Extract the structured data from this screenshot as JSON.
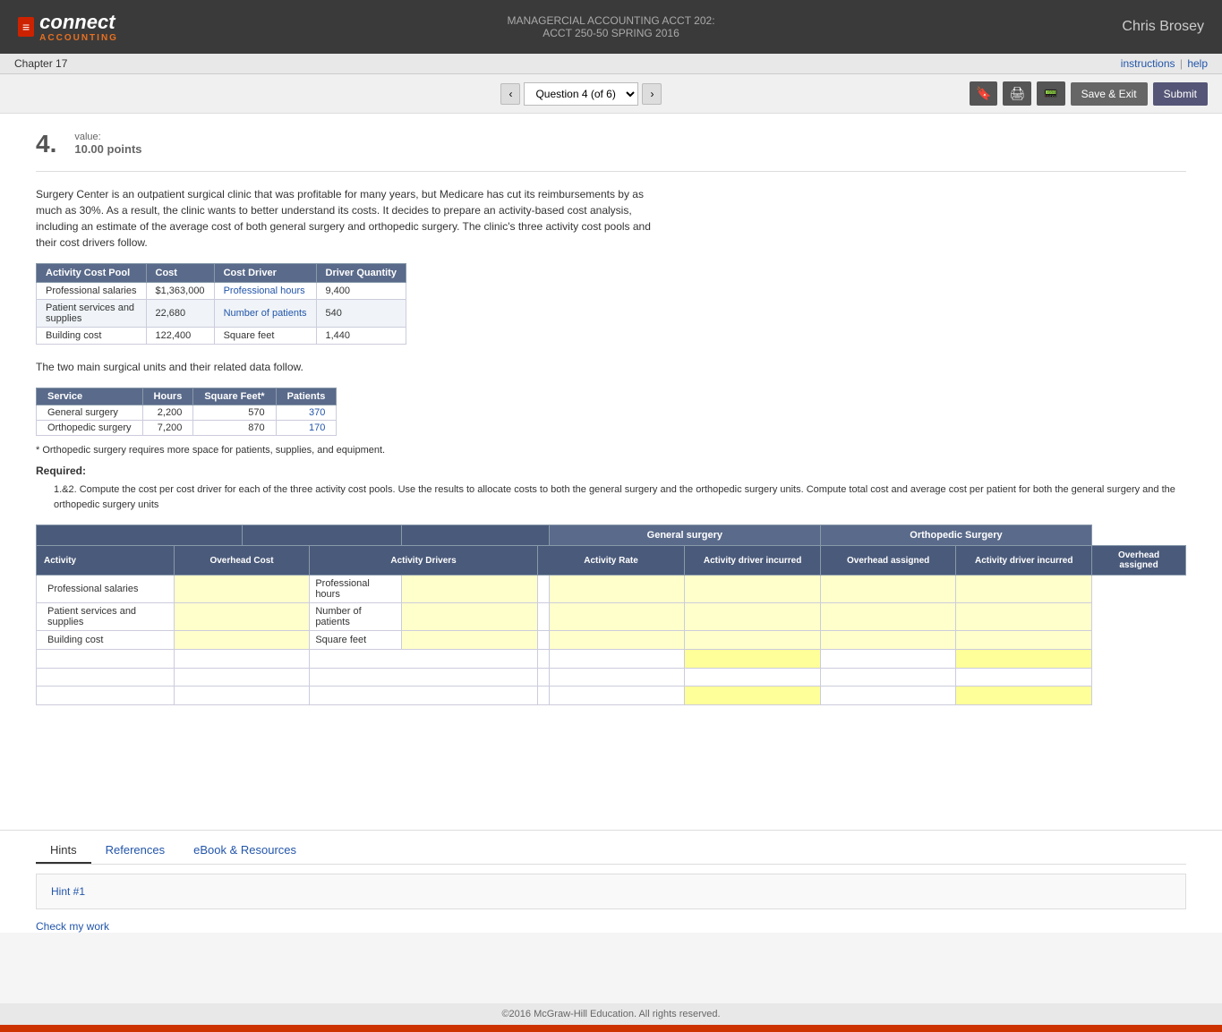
{
  "header": {
    "logo_icon": "≡",
    "logo_text": "connect",
    "logo_subtext": "ACCOUNTING",
    "course_line1": "MANAGERCIAL ACCOUNTING ACCT 202:",
    "course_line2": "ACCT 250-50 SPRING 2016",
    "user": "Chris Brosey"
  },
  "topbar": {
    "chapter": "Chapter 17",
    "links": {
      "instructions": "instructions",
      "separator": "|",
      "help": "help"
    }
  },
  "nav": {
    "prev_label": "‹",
    "question_select": "Question 4 (of 6)",
    "next_label": "›",
    "save_exit": "Save & Exit",
    "submit": "Submit"
  },
  "question": {
    "number": "4.",
    "value_label": "value:",
    "points": "10.00 points"
  },
  "problem": {
    "intro": "Surgery Center is an outpatient surgical clinic that was profitable for many years, but Medicare has cut its reimbursements by as much as 30%. As a result, the clinic wants to better understand its costs. It decides to prepare an activity-based cost analysis, including an estimate of the average cost of both general surgery and orthopedic surgery. The clinic's three activity cost pools and their cost drivers follow.",
    "cost_pool_table": {
      "headers": [
        "Activity Cost Pool",
        "Cost",
        "Cost Driver",
        "Driver Quantity"
      ],
      "rows": [
        [
          "Professional salaries",
          "$1,363,000",
          "Professional hours",
          "9,400"
        ],
        [
          "Patient services and supplies",
          "22,680",
          "Number of patients",
          "540"
        ],
        [
          "Building cost",
          "122,400",
          "Square feet",
          "1,440"
        ]
      ]
    },
    "service_table": {
      "headers": [
        "Service",
        "Hours",
        "Square Feet*",
        "Patients"
      ],
      "rows": [
        [
          "General surgery",
          "2,200",
          "570",
          "370"
        ],
        [
          "Orthopedic surgery",
          "7,200",
          "870",
          "170"
        ]
      ]
    },
    "footnote": "* Orthopedic surgery requires more space for patients, supplies, and equipment.",
    "required_label": "Required:",
    "required_detail": "1.&2. Compute the cost per cost driver for each of the three activity cost pools. Use the results to allocate costs to both the general surgery and the orthopedic surgery units. Compute total cost and average cost per patient for both the general surgery and the orthopedic surgery units"
  },
  "answer_table": {
    "col_groups": {
      "general_surgery": "General surgery",
      "orthopedic_surgery": "Orthopedic Surgery"
    },
    "sub_headers": {
      "activity": "Activity",
      "overhead_cost": "Overhead Cost",
      "activity_drivers": "Activity Drivers",
      "activity_rate": "Activity Rate",
      "gen_driver_incurred": "Activity driver incurred",
      "gen_overhead_assigned": "Overhead assigned",
      "orth_driver_incurred": "Activity driver incurred",
      "orth_overhead_assigned": "Overhead assigned"
    },
    "rows": [
      {
        "activity": "Professional salaries",
        "driver": "Professional hours"
      },
      {
        "activity": "Patient services and supplies",
        "driver": "Number of patients"
      },
      {
        "activity": "Building cost",
        "driver": "Square feet"
      }
    ]
  },
  "tabs": {
    "items": [
      "Hints",
      "References",
      "eBook & Resources"
    ],
    "active": "Hints"
  },
  "hints": {
    "hint1": "Hint #1"
  },
  "footer": {
    "copyright": "©2016 McGraw-Hill Education. All rights reserved."
  },
  "check_my_work": "Check my work"
}
